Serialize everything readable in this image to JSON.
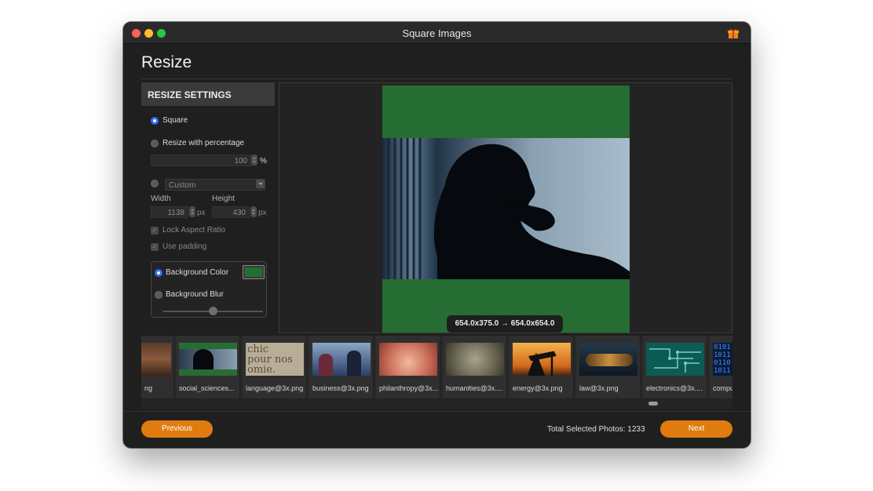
{
  "window": {
    "title": "Square Images"
  },
  "page": {
    "title": "Resize"
  },
  "settings": {
    "header": "RESIZE SETTINGS",
    "square_label": "Square",
    "percentage_label": "Resize with percentage",
    "percentage_value": "100",
    "percentage_unit": "%",
    "custom_placeholder": "Custom",
    "width_label": "Width",
    "height_label": "Height",
    "width_value": "1138",
    "height_value": "430",
    "px_unit": "px",
    "lock_aspect_label": "Lock Aspect Ratio",
    "use_padding_label": "Use padding",
    "background_color_label": "Background Color",
    "background_blur_label": "Background Blur",
    "background_color": "#256d32",
    "selected_mode": "Square",
    "selected_background": "Background Color"
  },
  "preview": {
    "size_badge": "654.0x375.0 → 654.0x654.0"
  },
  "thumbnails": [
    {
      "label": "ng",
      "icon": "photo-partial"
    },
    {
      "label": "social_sciences...",
      "icon": "photo-silhouette"
    },
    {
      "label": "language@3x.png",
      "icon": "photo-text"
    },
    {
      "label": "business@3x.png",
      "icon": "photo-business"
    },
    {
      "label": "philanthropy@3x...",
      "icon": "photo-hands"
    },
    {
      "label": "humanities@3x....",
      "icon": "photo-banknote"
    },
    {
      "label": "energy@3x.png",
      "icon": "photo-oil-pump"
    },
    {
      "label": "law@3x.png",
      "icon": "photo-gavel"
    },
    {
      "label": "electronics@3x....",
      "icon": "photo-circuit"
    },
    {
      "label": "compu",
      "icon": "photo-binary"
    }
  ],
  "footer": {
    "previous_label": "Previous",
    "next_label": "Next",
    "total_label": "Total Selected Photos: 1233"
  },
  "colors": {
    "accent": "#e07b0f",
    "radio_selected": "#2a6ff0"
  }
}
